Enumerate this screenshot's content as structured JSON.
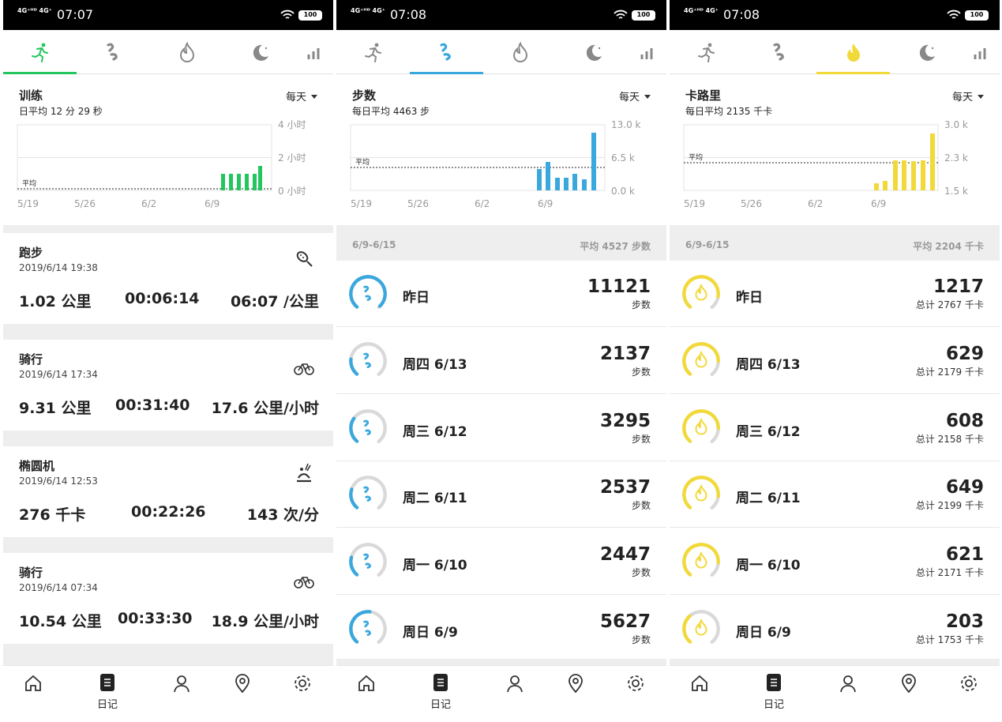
{
  "status_bars": [
    {
      "network": "4G⁺ᴴᴰ 4G⁺",
      "time": "07:07",
      "battery": "100"
    },
    {
      "network": "4G⁺ᴴᴰ 4G⁺",
      "time": "07:08",
      "battery": "100"
    },
    {
      "network": "4G⁺ᴴᴰ 4G⁺",
      "time": "07:08",
      "battery": "100"
    }
  ],
  "colors": {
    "training": "#22c55e",
    "steps": "#3aa8dd",
    "calories": "#f2d93a",
    "ring_bg": "#d9d9d9"
  },
  "tab_icons": [
    "running-icon",
    "footsteps-icon",
    "flame-icon",
    "moon-icon",
    "chart-icon"
  ],
  "x_ticks": [
    "5/19",
    "5/26",
    "6/2",
    "6/9"
  ],
  "avg_label": "平均",
  "range_dropdown": "每天",
  "panel1": {
    "chart": {
      "title": "训练",
      "subtitle": "日平均 12 分 29 秒",
      "y_ticks": [
        "4 小时",
        "2 小时",
        "0 小时"
      ]
    },
    "chart_data": {
      "type": "bar",
      "ylim_hours": [
        0,
        4
      ],
      "average_hours": 0.2,
      "last7_values_hours": [
        1.0,
        1.0,
        1.0,
        1.0,
        1.5
      ]
    },
    "activities": [
      {
        "name": "跑步",
        "datetime": "2019/6/14 19:38",
        "icon": "shoe-icon",
        "v1": "1.02 公里",
        "v2": "00:06:14",
        "v3": "06:07 /公里"
      },
      {
        "name": "骑行",
        "datetime": "2019/6/14 17:34",
        "icon": "bike-icon",
        "v1": "9.31 公里",
        "v2": "00:31:40",
        "v3": "17.6 公里/小时"
      },
      {
        "name": "椭圆机",
        "datetime": "2019/6/14 12:53",
        "icon": "elliptical-icon",
        "v1": "276 千卡",
        "v2": "00:22:26",
        "v3": "143 次/分"
      },
      {
        "name": "骑行",
        "datetime": "2019/6/14 07:34",
        "icon": "bike-icon",
        "v1": "10.54 公里",
        "v2": "00:33:30",
        "v3": "18.9 公里/小时"
      }
    ]
  },
  "panel2": {
    "chart": {
      "title": "步数",
      "subtitle": "每日平均 4463 步",
      "y_ticks": [
        "13.0 k",
        "6.5 k",
        "0.0 k"
      ]
    },
    "chart_data": {
      "type": "bar",
      "ylim": [
        0,
        13000
      ],
      "average": 4463,
      "last7_values": [
        4200,
        5627,
        2447,
        2537,
        3295,
        2137,
        11121
      ]
    },
    "week_range": "6/9-6/15",
    "week_avg": "平均 4527 步数",
    "rows": [
      {
        "day": "昨日",
        "value": "11121",
        "unit": "步数",
        "progress": 0.98
      },
      {
        "day": "周四 6/13",
        "value": "2137",
        "unit": "步数",
        "progress": 0.2
      },
      {
        "day": "周三 6/12",
        "value": "3295",
        "unit": "步数",
        "progress": 0.3
      },
      {
        "day": "周二 6/11",
        "value": "2537",
        "unit": "步数",
        "progress": 0.24
      },
      {
        "day": "周一 6/10",
        "value": "2447",
        "unit": "步数",
        "progress": 0.23
      },
      {
        "day": "周日 6/9",
        "value": "5627",
        "unit": "步数",
        "progress": 0.52
      }
    ]
  },
  "panel3": {
    "chart": {
      "title": "卡路里",
      "subtitle": "每日平均 2135 千卡",
      "y_ticks": [
        "3.0 k",
        "2.3 k",
        "1.5 k"
      ]
    },
    "chart_data": {
      "type": "bar",
      "ylim": [
        1500,
        3000
      ],
      "average": 2135,
      "last7_values": [
        1650,
        1700,
        2200,
        2200,
        2180,
        2200,
        2767
      ]
    },
    "week_range": "6/9-6/15",
    "week_avg": "平均 2204 千卡",
    "rows": [
      {
        "day": "昨日",
        "value": "1217",
        "unit": "总计 2767 千卡",
        "progress": 0.85
      },
      {
        "day": "周四 6/13",
        "value": "629",
        "unit": "总计 2179 千卡",
        "progress": 0.82
      },
      {
        "day": "周三 6/12",
        "value": "608",
        "unit": "总计 2158 千卡",
        "progress": 0.82
      },
      {
        "day": "周二 6/11",
        "value": "649",
        "unit": "总计 2199 千卡",
        "progress": 0.84
      },
      {
        "day": "周一 6/10",
        "value": "621",
        "unit": "总计 2171 千卡",
        "progress": 0.83
      },
      {
        "day": "周日 6/9",
        "value": "203",
        "unit": "总计 1753 千卡",
        "progress": 0.35
      }
    ]
  },
  "bottom_nav": {
    "diary_label": "日记",
    "icons": [
      "home-icon",
      "diary-icon",
      "profile-icon",
      "location-icon",
      "settings-icon"
    ]
  }
}
